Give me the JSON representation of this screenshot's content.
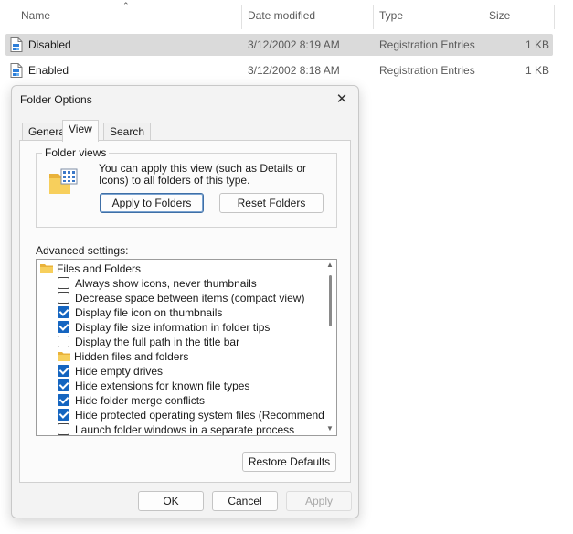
{
  "explorer": {
    "columns": {
      "name": "Name",
      "date": "Date modified",
      "type": "Type",
      "size": "Size"
    },
    "files": [
      {
        "name": "Disabled",
        "date": "3/12/2002 8:19 AM",
        "type": "Registration Entries",
        "size": "1 KB",
        "selected": true,
        "icon": "registry-file-icon"
      },
      {
        "name": "Enabled",
        "date": "3/12/2002 8:18 AM",
        "type": "Registration Entries",
        "size": "1 KB",
        "selected": false,
        "icon": "registry-file-icon"
      }
    ]
  },
  "dialog": {
    "title": "Folder Options",
    "tabs": [
      "General",
      "View",
      "Search"
    ],
    "active_tab": "View",
    "folder_views": {
      "label": "Folder views",
      "description": "You can apply this view (such as Details or Icons) to all folders of this type.",
      "apply_label": "Apply to Folders",
      "reset_label": "Reset Folders"
    },
    "advanced_label": "Advanced settings:",
    "settings": [
      {
        "kind": "category",
        "label": "Files and Folders"
      },
      {
        "kind": "option",
        "label": "Always show icons, never thumbnails",
        "checked": false
      },
      {
        "kind": "option",
        "label": "Decrease space between items (compact view)",
        "checked": false
      },
      {
        "kind": "option",
        "label": "Display file icon on thumbnails",
        "checked": true
      },
      {
        "kind": "option",
        "label": "Display file size information in folder tips",
        "checked": true
      },
      {
        "kind": "option",
        "label": "Display the full path in the title bar",
        "checked": false
      },
      {
        "kind": "option",
        "label": "Hidden files and folders",
        "checked": null,
        "folder": true
      },
      {
        "kind": "option",
        "label": "Hide empty drives",
        "checked": true
      },
      {
        "kind": "option",
        "label": "Hide extensions for known file types",
        "checked": true
      },
      {
        "kind": "option",
        "label": "Hide folder merge conflicts",
        "checked": true
      },
      {
        "kind": "option",
        "label": "Hide protected operating system files (Recommended)",
        "checked": true
      },
      {
        "kind": "option",
        "label": "Launch folder windows in a separate process",
        "checked": false
      }
    ],
    "restore_label": "Restore Defaults",
    "ok_label": "OK",
    "cancel_label": "Cancel",
    "apply_label": "Apply",
    "colors": {
      "accent": "#1565c0",
      "folder": "#f5c242"
    }
  }
}
